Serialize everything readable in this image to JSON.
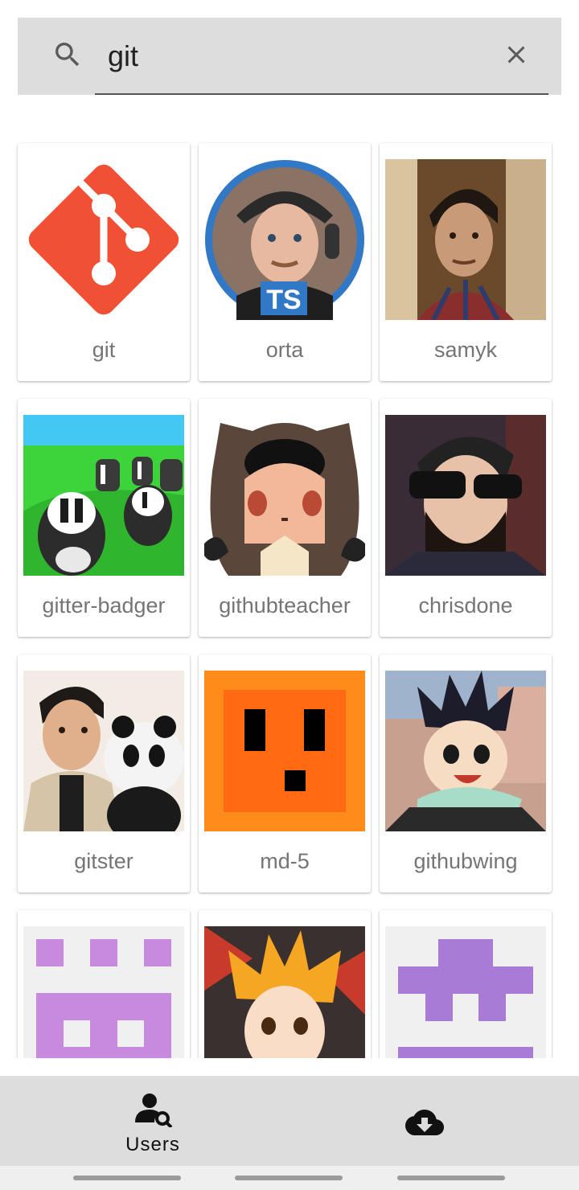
{
  "search": {
    "query": "git",
    "icons": {
      "search": "search-icon",
      "clear": "close-icon"
    }
  },
  "users": [
    {
      "login": "git"
    },
    {
      "login": "orta"
    },
    {
      "login": "samyk"
    },
    {
      "login": "gitter-badger"
    },
    {
      "login": "githubteacher"
    },
    {
      "login": "chrisdone"
    },
    {
      "login": "gitster"
    },
    {
      "login": "md-5"
    },
    {
      "login": "githubwing"
    },
    {
      "login": ""
    },
    {
      "login": ""
    },
    {
      "login": ""
    }
  ],
  "bottom_nav": {
    "users_label": "Users",
    "icons": {
      "users": "user-search-icon",
      "download": "cloud-download-icon"
    }
  },
  "colors": {
    "search_bar_bg": "#dddddd",
    "bottom_nav_bg": "#dddddd",
    "label_text": "#757575",
    "git_logo": "#f05033",
    "identicon_purple": "#a87cd6"
  }
}
